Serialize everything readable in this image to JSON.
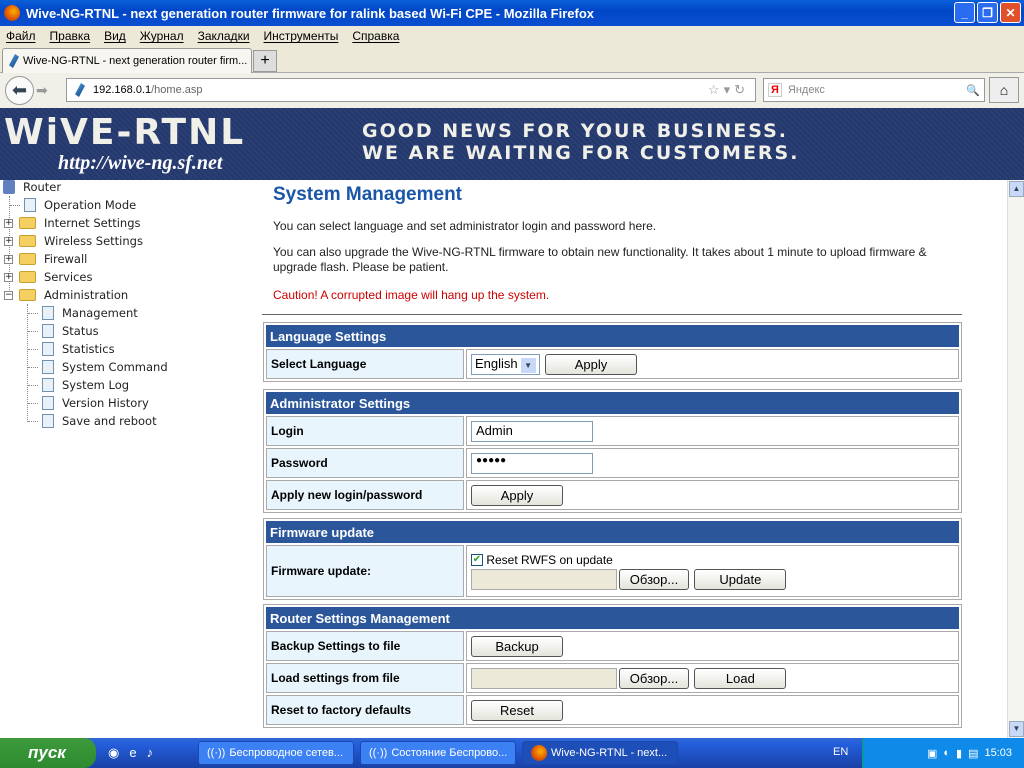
{
  "window": {
    "title": "Wive-NG-RTNL - next generation router firmware for ralink based Wi-Fi CPE - Mozilla Firefox"
  },
  "menu": [
    "Файл",
    "Правка",
    "Вид",
    "Журнал",
    "Закладки",
    "Инструменты",
    "Справка"
  ],
  "tab": {
    "label": "Wive-NG-RTNL - next generation router firm...",
    "new": "+"
  },
  "nav": {
    "url_host": "192.168.0.1",
    "url_path": "/home.asp",
    "search_placeholder": "Яндекс",
    "search_engine": "Я"
  },
  "banner": {
    "logo": "WiVE-RTNL",
    "site": "http://wive-ng.sf.net",
    "slogan1": "GOOD NEWS FOR YOUR BUSINESS.",
    "slogan2": "WE ARE WAITING FOR CUSTOMERS."
  },
  "tree": {
    "root": "Router",
    "items": [
      "Operation Mode",
      "Internet Settings",
      "Wireless Settings",
      "Firewall",
      "Services",
      "Administration"
    ],
    "admin_children": [
      "Management",
      "Status",
      "Statistics",
      "System Command",
      "System Log",
      "Version History",
      "Save and reboot"
    ]
  },
  "page": {
    "title": "System Management",
    "intro1": "You can select language and set administrator login and password here.",
    "intro2": "You can also upgrade the Wive-NG-RTNL firmware to obtain new functionality. It takes about 1 minute to upload firmware & upgrade flash. Please be patient.",
    "caution": "Caution! A corrupted image will hang up the system.",
    "language": {
      "header": "Language Settings",
      "label": "Select Language",
      "value": "English",
      "apply": "Apply"
    },
    "admin": {
      "header": "Administrator Settings",
      "login_label": "Login",
      "login_value": "Admin",
      "password_label": "Password",
      "password_value": "●●●●●",
      "apply_label": "Apply new login/password",
      "apply": "Apply"
    },
    "firmware": {
      "header": "Firmware update",
      "label": "Firmware update:",
      "reset_rwfs": "Reset RWFS on update",
      "reset_rwfs_checked": true,
      "browse": "Обзор...",
      "update": "Update"
    },
    "router": {
      "header": "Router Settings Management",
      "backup_label": "Backup Settings to file",
      "backup": "Backup",
      "load_label": "Load settings from file",
      "browse": "Обзор...",
      "load": "Load",
      "reset_label": "Reset to factory defaults",
      "reset": "Reset"
    }
  },
  "taskbar": {
    "start": "пуск",
    "items": [
      "Беспроводное сетев...",
      "Состояние Беспрово...",
      "Wive-NG-RTNL - next..."
    ],
    "lang": "EN",
    "clock": "15:03"
  }
}
